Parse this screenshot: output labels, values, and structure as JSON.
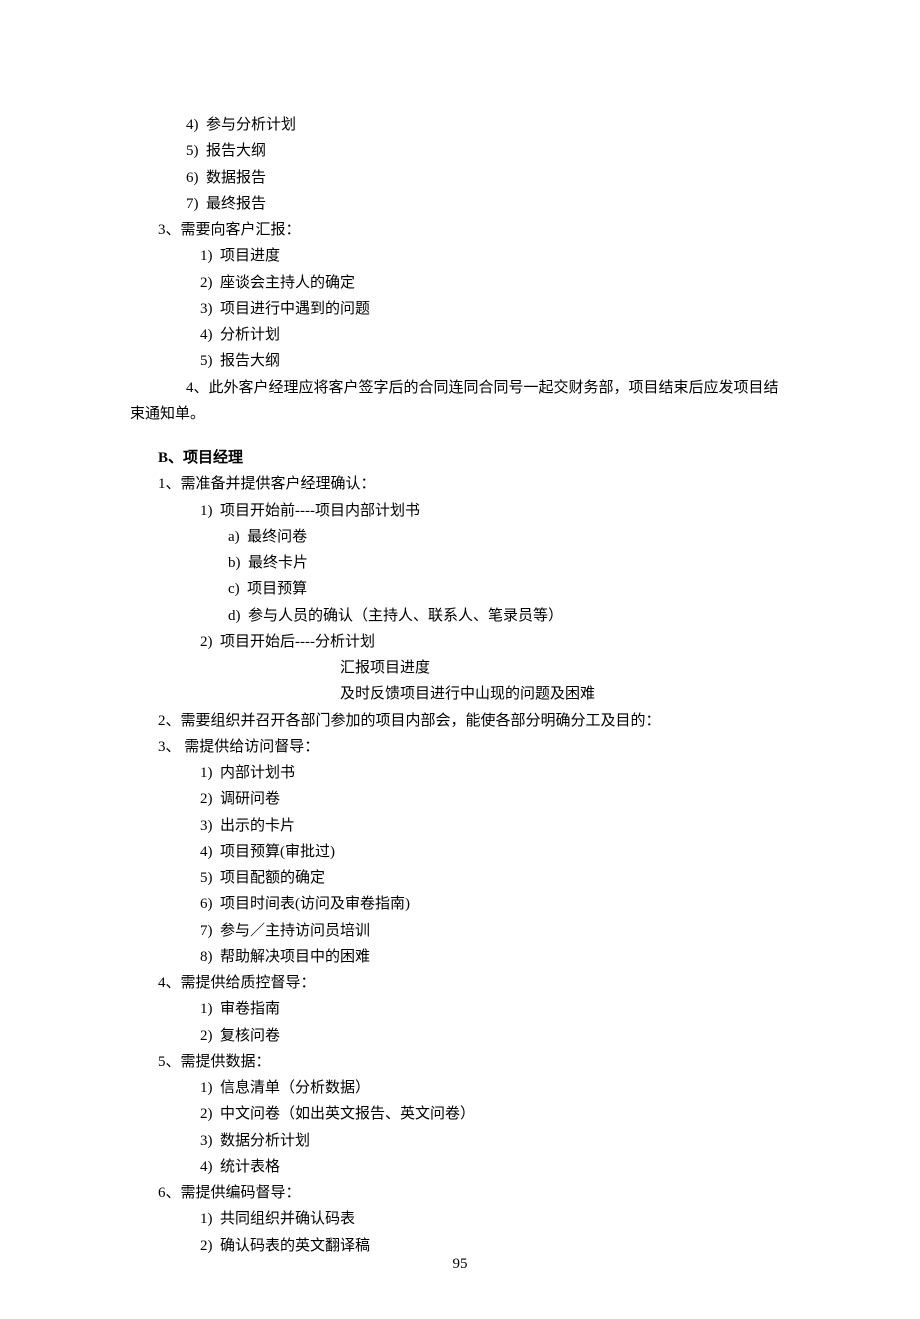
{
  "topList": {
    "items": [
      {
        "num": "4)",
        "text": "参与分析计划"
      },
      {
        "num": "5)",
        "text": "报告大纲"
      },
      {
        "num": "6)",
        "text": "数据报告"
      },
      {
        "num": "7)",
        "text": "最终报告"
      }
    ]
  },
  "sectionA3": {
    "heading": "3、需要向客户汇报：",
    "items": [
      {
        "num": "1)",
        "text": "项目进度"
      },
      {
        "num": "2)",
        "text": "座谈会主持人的确定"
      },
      {
        "num": "3)",
        "text": "项目进行中遇到的问题"
      },
      {
        "num": "4)",
        "text": "分析计划"
      },
      {
        "num": "5)",
        "text": "报告大纲"
      }
    ]
  },
  "sectionA4": {
    "text": "4、此外客户经理应将客户签字后的合同连同合同号一起交财务部，项目结束后应发项目结束通知单。"
  },
  "sectionB": {
    "title": "B、项目经理",
    "b1": {
      "heading": "1、需准备并提供客户经理确认：",
      "sub1": {
        "label": "1)  项目开始前----项目内部计划书",
        "items": [
          {
            "num": "a)",
            "text": "最终问卷"
          },
          {
            "num": "b)",
            "text": "最终卡片"
          },
          {
            "num": "c)",
            "text": "项目预算"
          },
          {
            "num": "d)",
            "text": "参与人员的确认（主持人、联系人、笔录员等）"
          }
        ]
      },
      "sub2": {
        "label": "2)  项目开始后----分析计划",
        "lines": [
          "汇报项目进度",
          "及时反馈项目进行中山现的问题及困难"
        ]
      }
    },
    "b2": {
      "heading": "2、需要组织并召开各部门参加的项目内部会，能使各部分明确分工及目的："
    },
    "b3": {
      "heading": "3、 需提供给访问督导：",
      "items": [
        {
          "num": "1)",
          "text": "内部计划书"
        },
        {
          "num": "2)",
          "text": "调研问卷"
        },
        {
          "num": "3)",
          "text": "出示的卡片"
        },
        {
          "num": "4)",
          "text": "项目预算(审批过)"
        },
        {
          "num": "5)",
          "text": "项目配额的确定"
        },
        {
          "num": "6)",
          "text": "项目时间表(访问及审卷指南)"
        },
        {
          "num": "7)",
          "text": "参与／主持访问员培训"
        },
        {
          "num": "8)",
          "text": "帮助解决项目中的困难"
        }
      ]
    },
    "b4": {
      "heading": "4、需提供给质控督导：",
      "items": [
        {
          "num": "1)",
          "text": "审卷指南"
        },
        {
          "num": "2)",
          "text": "复核问卷"
        }
      ]
    },
    "b5": {
      "heading": "5、需提供数据：",
      "items": [
        {
          "num": "1)",
          "text": "信息清单（分析数据）"
        },
        {
          "num": "2)",
          "text": "中文问卷（如出英文报告、英文问卷）"
        },
        {
          "num": "3)",
          "text": "数据分析计划"
        },
        {
          "num": "4)",
          "text": "统计表格"
        }
      ]
    },
    "b6": {
      "heading": "6、需提供编码督导：",
      "items": [
        {
          "num": "1)",
          "text": "共同组织并确认码表"
        },
        {
          "num": "2)",
          "text": "确认码表的英文翻译稿"
        }
      ]
    }
  },
  "pageNumber": "95"
}
